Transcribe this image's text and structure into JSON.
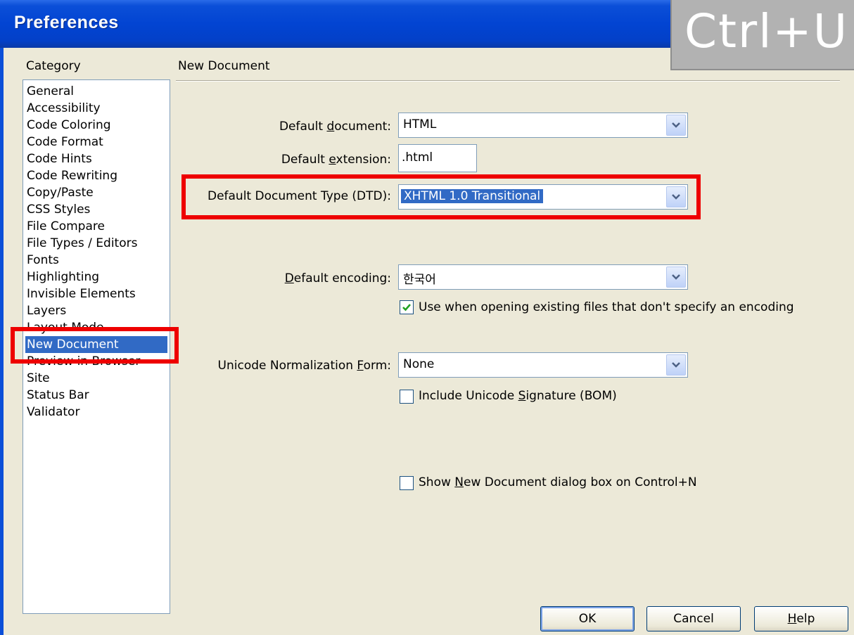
{
  "window": {
    "title": "Preferences"
  },
  "overlay": {
    "shortcut_text": "Ctrl+U"
  },
  "category": {
    "heading": "Category",
    "items": [
      "General",
      "Accessibility",
      "Code Coloring",
      "Code Format",
      "Code Hints",
      "Code Rewriting",
      "Copy/Paste",
      "CSS Styles",
      "File Compare",
      "File Types / Editors",
      "Fonts",
      "Highlighting",
      "Invisible Elements",
      "Layers",
      "Layout Mode",
      "New Document",
      "Preview in Browser",
      "Site",
      "Status Bar",
      "Validator"
    ],
    "selected": "New Document"
  },
  "panel": {
    "title": "New Document",
    "default_document": {
      "label_pre": "Default ",
      "label_key": "d",
      "label_post": "ocument:",
      "value": "HTML"
    },
    "default_extension": {
      "label_pre": "Default ",
      "label_key": "e",
      "label_post": "xtension:",
      "value": ".html"
    },
    "default_dtd": {
      "label": "Default Document Type (DTD):",
      "value": "XHTML 1.0 Transitional"
    },
    "default_encoding": {
      "label_pre": "",
      "label_key": "D",
      "label_post": "efault encoding:",
      "value": "한국어"
    },
    "use_when_opening": {
      "label": "Use when opening existing files that don't specify an encoding",
      "checked": true
    },
    "unicode_form": {
      "label_pre": "Unicode Normalization ",
      "label_key": "F",
      "label_post": "orm:",
      "value": "None"
    },
    "include_bom": {
      "label_pre": "Include Unicode ",
      "label_key": "S",
      "label_post": "ignature (BOM)",
      "checked": false
    },
    "show_dialog": {
      "label_pre": "Show ",
      "label_key": "N",
      "label_post": "ew Document dialog box on Control+N",
      "checked": false
    }
  },
  "buttons": {
    "ok": "OK",
    "cancel": "Cancel",
    "help_key": "H",
    "help_rest": "elp"
  },
  "colors": {
    "highlight": "#ee0000",
    "selection": "#316ac5",
    "titlebar": "#0244d2"
  }
}
